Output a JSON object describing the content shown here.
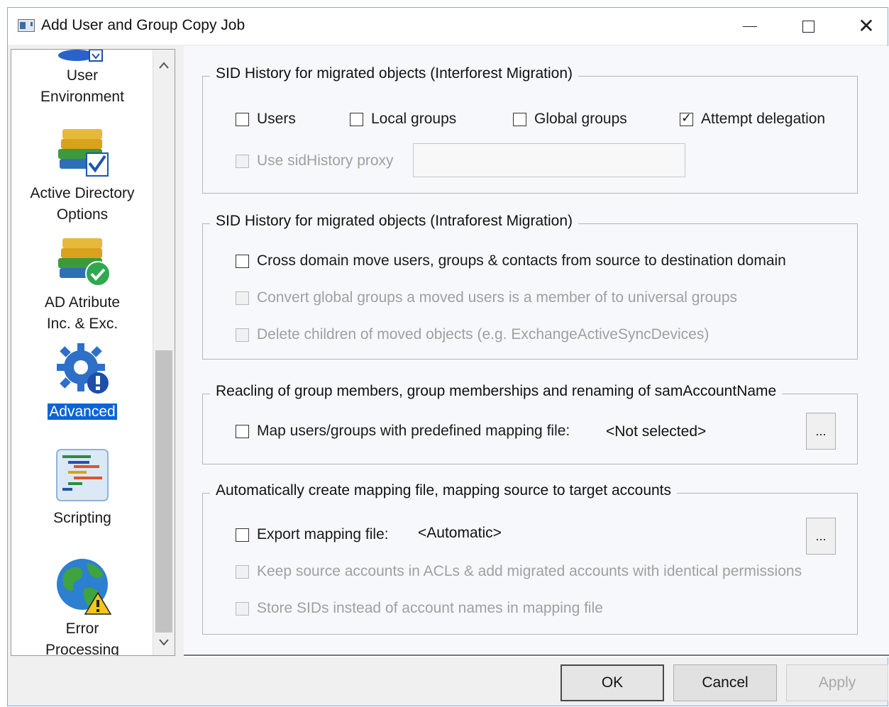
{
  "window": {
    "title": "Add User and Group Copy Job",
    "controls": {
      "minimize": "minimize-icon",
      "maximize": "maximize-icon",
      "close": "close-icon"
    }
  },
  "sidebar": {
    "items": [
      {
        "label_line1": "User",
        "label_line2": "Environment",
        "icon": "user-environment-icon",
        "selected": false
      },
      {
        "label_line1": "Active Directory",
        "label_line2": "Options",
        "icon": "books-check-icon",
        "selected": false
      },
      {
        "label_line1": "AD Atribute",
        "label_line2": "Inc. & Exc.",
        "icon": "books-checkmark-icon",
        "selected": false
      },
      {
        "label_line1": "Advanced",
        "label_line2": "",
        "icon": "gear-alert-icon",
        "selected": true
      },
      {
        "label_line1": "Scripting",
        "label_line2": "",
        "icon": "script-icon",
        "selected": false
      },
      {
        "label_line1": "Error",
        "label_line2": "Processing",
        "icon": "globe-warning-icon",
        "selected": false
      }
    ]
  },
  "groups": {
    "interforest": {
      "legend": "SID History for migrated objects (Interforest Migration)",
      "users": {
        "label": "Users",
        "checked": false
      },
      "local_groups": {
        "label": "Local groups",
        "checked": false
      },
      "global_groups": {
        "label": "Global groups",
        "checked": false
      },
      "attempt_delegation": {
        "label": "Attempt delegation",
        "checked": true
      },
      "use_proxy": {
        "label": "Use sidHistory proxy",
        "checked": false,
        "disabled": true
      },
      "proxy_value": ""
    },
    "intraforest": {
      "legend": "SID History for migrated objects (Intraforest Migration)",
      "cross_domain": {
        "label": "Cross domain move users, groups & contacts from source to destination domain",
        "checked": false
      },
      "convert_global": {
        "label": "Convert global groups a moved users is a member of to universal groups",
        "checked": false,
        "disabled": true
      },
      "delete_children": {
        "label": "Delete children of moved objects (e.g. ExchangeActiveSyncDevices)",
        "checked": false,
        "disabled": true
      }
    },
    "reacling": {
      "legend": "Reacling of group members, group memberships and renaming of samAccountName",
      "map_users": {
        "label": "Map users/groups with predefined mapping file:",
        "checked": false
      },
      "map_value": "<Not selected>",
      "browse_label": "..."
    },
    "auto_mapping": {
      "legend": "Automatically create mapping file, mapping source to target accounts",
      "export": {
        "label": "Export mapping file:",
        "checked": false
      },
      "export_value": "<Automatic>",
      "browse_label": "...",
      "keep_source": {
        "label": "Keep source accounts in ACLs & add migrated accounts with identical permissions",
        "checked": false,
        "disabled": true
      },
      "store_sids": {
        "label": "Store SIDs instead of account names in mapping file",
        "checked": false,
        "disabled": true
      }
    }
  },
  "buttons": {
    "ok": "OK",
    "cancel": "Cancel",
    "apply": "Apply"
  }
}
